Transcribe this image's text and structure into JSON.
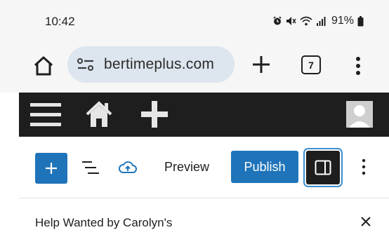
{
  "status_bar": {
    "time": "10:42",
    "battery_percent": "91%",
    "icons": [
      "alarm-icon",
      "mute-icon",
      "wifi-icon",
      "signal-icon",
      "battery-icon"
    ]
  },
  "browser": {
    "url": "bertimeplus.com",
    "tab_count": "7",
    "icons": [
      "home-icon",
      "site-settings-icon",
      "new-tab-icon",
      "overflow-menu-icon"
    ]
  },
  "admin_bar": {
    "icons": [
      "hamburger-icon",
      "house-icon",
      "plus-icon",
      "avatar-icon"
    ],
    "colors": {
      "background": "#1e1e1e",
      "icon": "#e6e6e6"
    }
  },
  "editor_toolbar": {
    "preview_label": "Preview",
    "publish_label": "Publish",
    "icons": [
      "add-block-icon",
      "list-view-icon",
      "cloud-upload-icon",
      "sidebar-icon",
      "kebab-icon"
    ],
    "colors": {
      "accent": "#1f74b9"
    }
  },
  "post": {
    "title": "Help Wanted by Carolyn's"
  }
}
